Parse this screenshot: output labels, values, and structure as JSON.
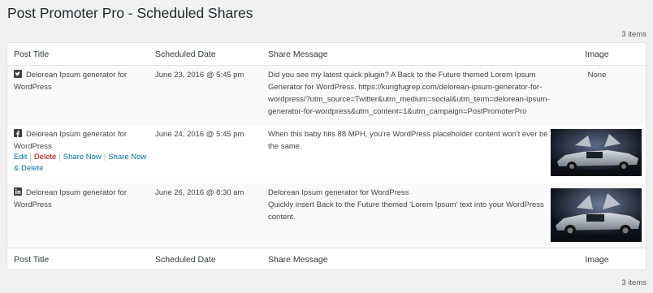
{
  "page": {
    "title": "Post Promoter Pro - Scheduled Shares"
  },
  "pagination": {
    "top_count": "3 items",
    "bottom_count": "3 items"
  },
  "table": {
    "columns": {
      "post_title": "Post Title",
      "scheduled_date": "Scheduled Date",
      "share_message": "Share Message",
      "image": "Image"
    },
    "row_actions": {
      "edit": "Edit",
      "delete": "Delete",
      "share_now": "Share Now",
      "share_now_delete": "Share Now & Delete",
      "separator": "|"
    },
    "rows": [
      {
        "network": "twitter",
        "network_icon": "twitter-icon",
        "post_title": "Delorean Ipsum generator for WordPress",
        "scheduled_date": "June 23, 2016 @ 5:45 pm",
        "share_message": "Did you see my latest quick plugin? A Back to the Future themed Lorem Ipsum Generator for WordPress. https://kungfugrep.com/delorean-ipsum-generator-for-wordpress/?utm_source=Twitter&utm_medium=social&utm_term=delorean-ipsum-generator-for-wordpress&utm_content=1&utm_campaign=PostPromoterPro",
        "image": "None"
      },
      {
        "network": "facebook",
        "network_icon": "facebook-icon",
        "post_title": "Delorean Ipsum generator for WordPress",
        "scheduled_date": "June 24, 2016 @ 5:45 pm",
        "share_message": "When this baby hits 88 MPH, you're WordPress placeholder content won't ever be the same.",
        "image_icon": "delorean-thumbnail"
      },
      {
        "network": "linkedin",
        "network_icon": "linkedin-icon",
        "post_title": "Delorean Ipsum generator for WordPress",
        "scheduled_date": "June 26, 2016 @ 8:30 am",
        "share_message_title": "Delorean Ipsum generator for WordPress",
        "share_message": "Quickly insert Back to the Future themed 'Lorem Ipsum' text into your WordPress content.",
        "image_icon": "delorean-thumbnail"
      }
    ]
  },
  "colors": {
    "link": "#0073aa",
    "delete": "#a00000",
    "header_text": "#23282d",
    "body_bg": "#f1f1f1"
  }
}
